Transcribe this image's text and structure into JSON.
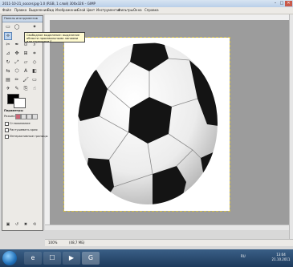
{
  "window": {
    "title": "2011-10-21_soccer.jpg-1.0 (RGB, 1 слой) 300x326 – GIMP",
    "controls": [
      "–",
      "□",
      "✕"
    ]
  },
  "menu": [
    "Файл",
    "Правка",
    "Выделение",
    "Вид",
    "Изображение",
    "Слой",
    "Цвет",
    "Инструменты",
    "Фильтры",
    "Окна",
    "Справка"
  ],
  "toolbox": {
    "title": "Панель инструментов",
    "tooltip": "Свободное выделение: выделение области произвольными линиями или отрезками  F",
    "options_title": "Параметры",
    "mode_label": "Режим:",
    "options": [
      "Сглаживание",
      "Растушевать края",
      "Интерактивные границы"
    ]
  },
  "status": {
    "zoom": "100%",
    "text": "(48,7 МБ)"
  },
  "taskbar": {
    "apps": [
      "e",
      "☐",
      "▶",
      "G"
    ],
    "tray": "RU",
    "time": "13:04",
    "date": "21.10.2011"
  },
  "colors": {
    "title_blue": "#c9d7e8",
    "taskbar": "#1d3a5c",
    "tooltip": "#fffbd0"
  }
}
